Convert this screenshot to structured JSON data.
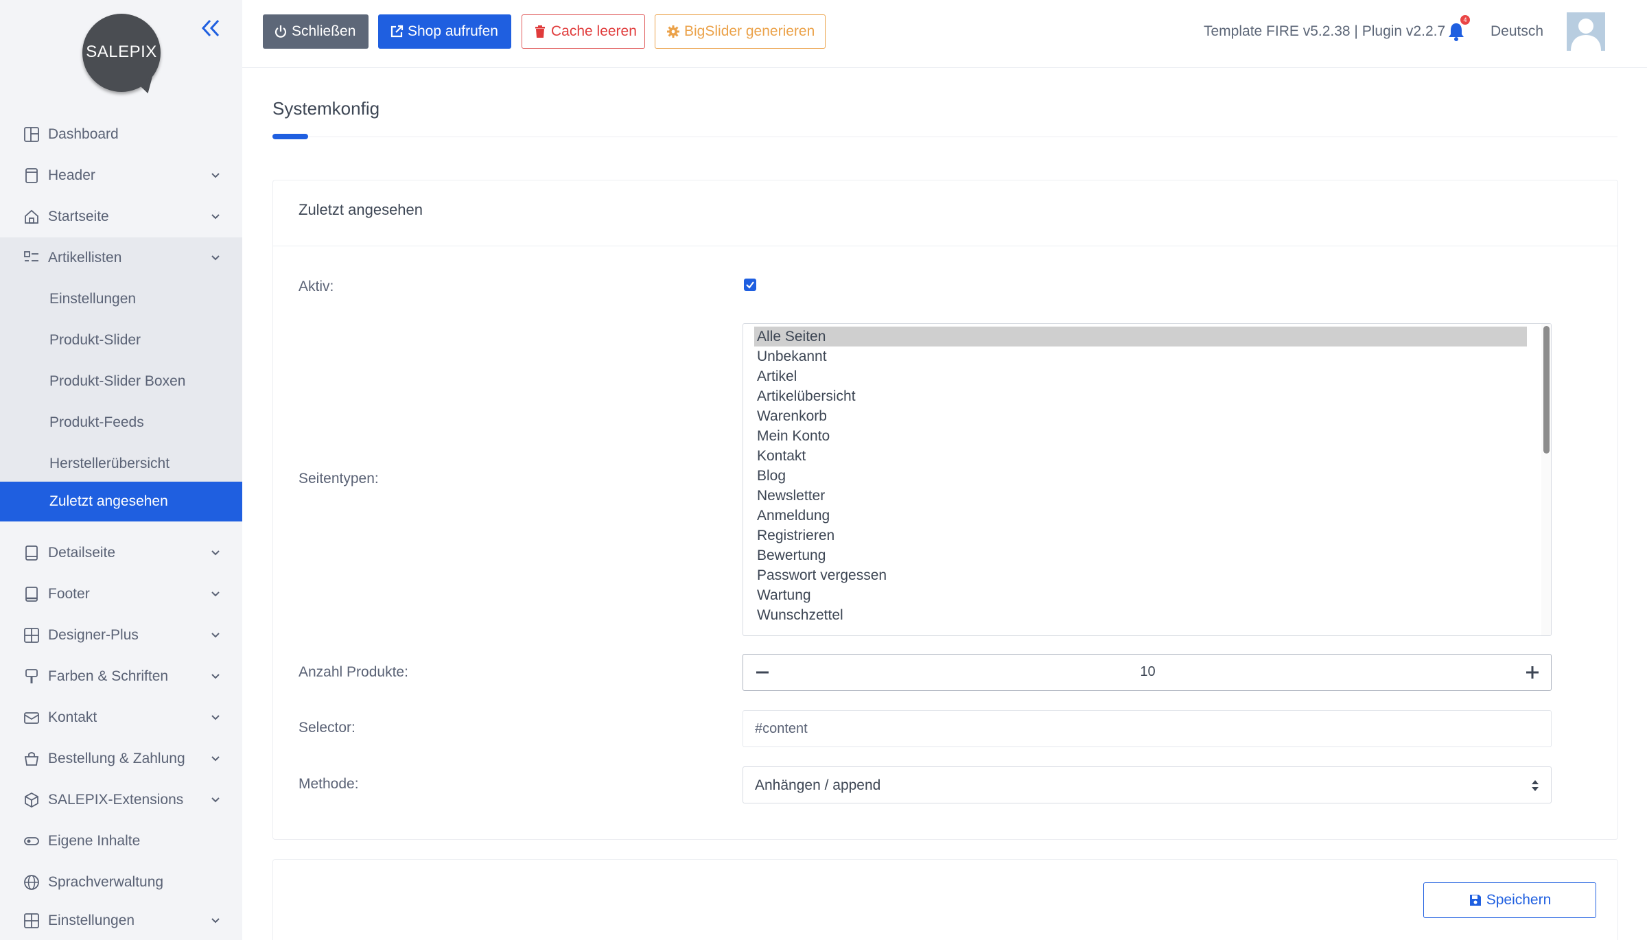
{
  "brand": {
    "logo_text": "SALEPIX"
  },
  "sidebar": {
    "collapse_icon": "double-chevron-left-icon",
    "items": [
      {
        "label": "Dashboard",
        "icon": "dashboard-icon"
      },
      {
        "label": "Header",
        "icon": "header-icon"
      },
      {
        "label": "Startseite",
        "icon": "home-icon"
      },
      {
        "label": "Artikellisten",
        "icon": "list-icon"
      },
      {
        "label": "Detailseite",
        "icon": "detail-icon"
      },
      {
        "label": "Footer",
        "icon": "footer-icon"
      },
      {
        "label": "Designer-Plus",
        "icon": "layout-icon"
      },
      {
        "label": "Farben & Schriften",
        "icon": "brush-icon"
      },
      {
        "label": "Kontakt",
        "icon": "mail-icon"
      },
      {
        "label": "Bestellung & Zahlung",
        "icon": "basket-icon"
      },
      {
        "label": "SALEPIX-Extensions",
        "icon": "box-icon"
      },
      {
        "label": "Eigene Inhalte",
        "icon": "toggle-icon"
      },
      {
        "label": "Sprachverwaltung",
        "icon": "globe-icon"
      },
      {
        "label": "Einstellungen",
        "icon": "settings-grid-icon"
      }
    ],
    "subitems": [
      {
        "label": "Einstellungen"
      },
      {
        "label": "Produkt-Slider"
      },
      {
        "label": "Produkt-Slider Boxen"
      },
      {
        "label": "Produkt-Feeds"
      },
      {
        "label": "Herstellerübersicht"
      },
      {
        "label": "Zuletzt angesehen"
      }
    ]
  },
  "toolbar": {
    "close_label": "Schließen",
    "shop_label": "Shop aufrufen",
    "cache_label": "Cache leeren",
    "slider_label": "BigSlider generieren",
    "version": "Template FIRE v5.2.38 | Plugin v2.2.7",
    "notification_count": "4",
    "language": "Deutsch"
  },
  "main": {
    "title": "Systemkonfig",
    "card_title": "Zuletzt angesehen",
    "form": {
      "active_label": "Aktiv:",
      "active_checked": true,
      "pagetypes_label": "Seitentypen:",
      "pagetypes_options": [
        "Alle Seiten",
        "Unbekannt",
        "Artikel",
        "Artikelübersicht",
        "Warenkorb",
        "Mein Konto",
        "Kontakt",
        "Blog",
        "Newsletter",
        "Anmeldung",
        "Registrieren",
        "Bewertung",
        "Passwort vergessen",
        "Wartung",
        "Wunschzettel"
      ],
      "pagetypes_selected": "Alle Seiten",
      "count_label": "Anzahl Produkte:",
      "count_value": "10",
      "selector_label": "Selector:",
      "selector_value": "#content",
      "method_label": "Methode:",
      "method_value": "Anhängen / append"
    },
    "save_label": "Speichern"
  },
  "colors": {
    "accent": "#1f5fe0",
    "sidebar_bg": "#f3f4f7",
    "danger": "#e03b3b",
    "warning": "#eba24a"
  }
}
